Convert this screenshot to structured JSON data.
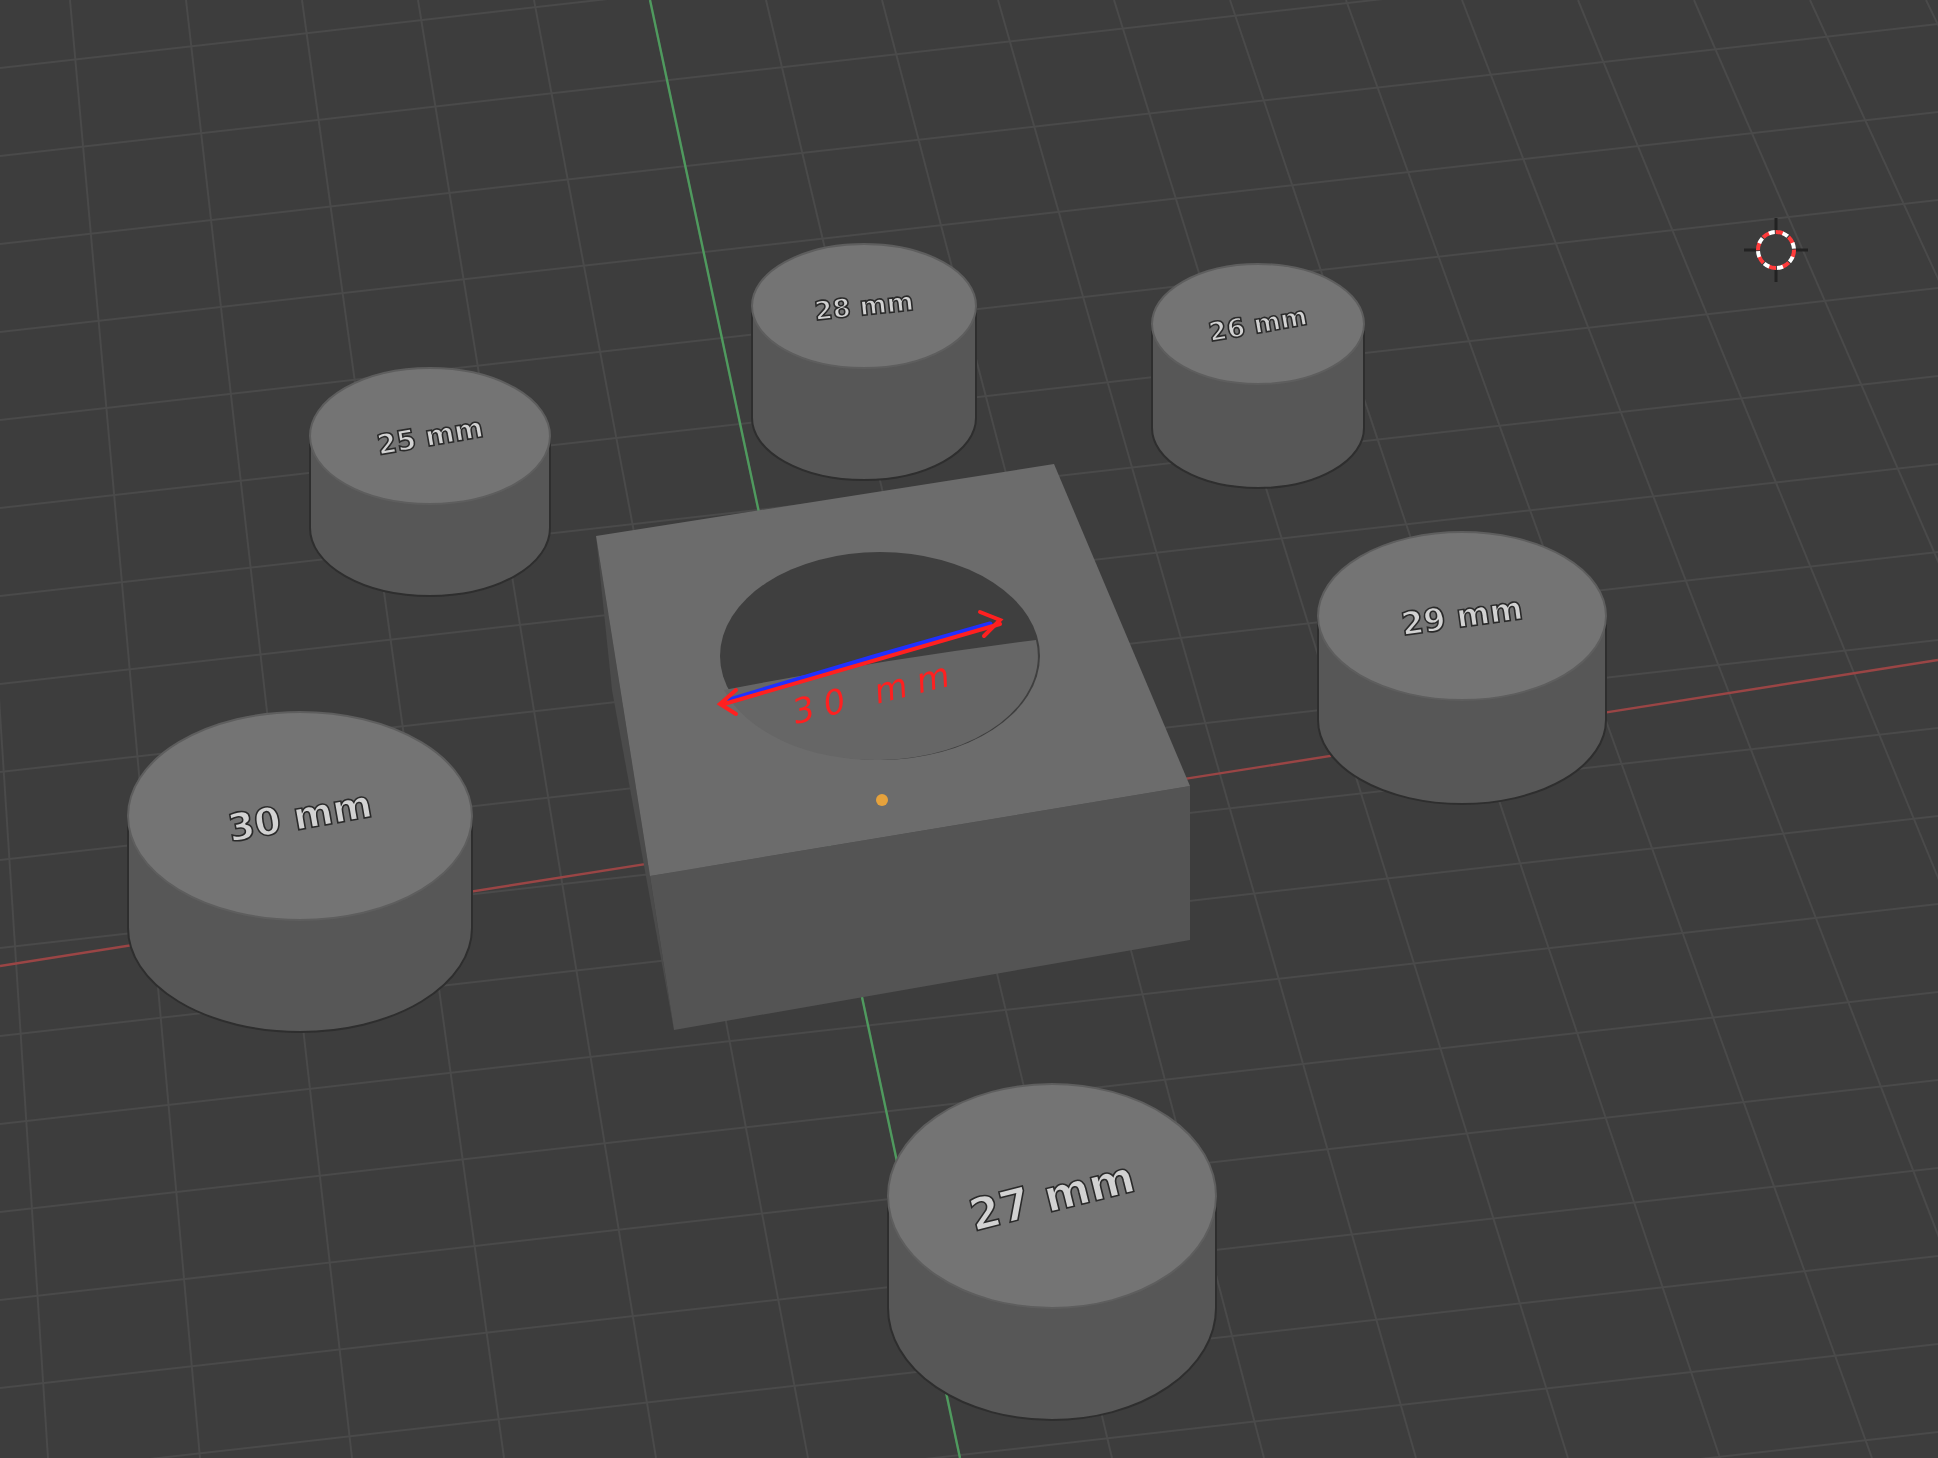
{
  "cylinders": [
    {
      "label": "28 mm"
    },
    {
      "label": "26 mm"
    },
    {
      "label": "25 mm"
    },
    {
      "label": "29 mm"
    },
    {
      "label": "30 mm"
    },
    {
      "label": "27 mm"
    }
  ],
  "annotation": {
    "text": "30 mm"
  }
}
